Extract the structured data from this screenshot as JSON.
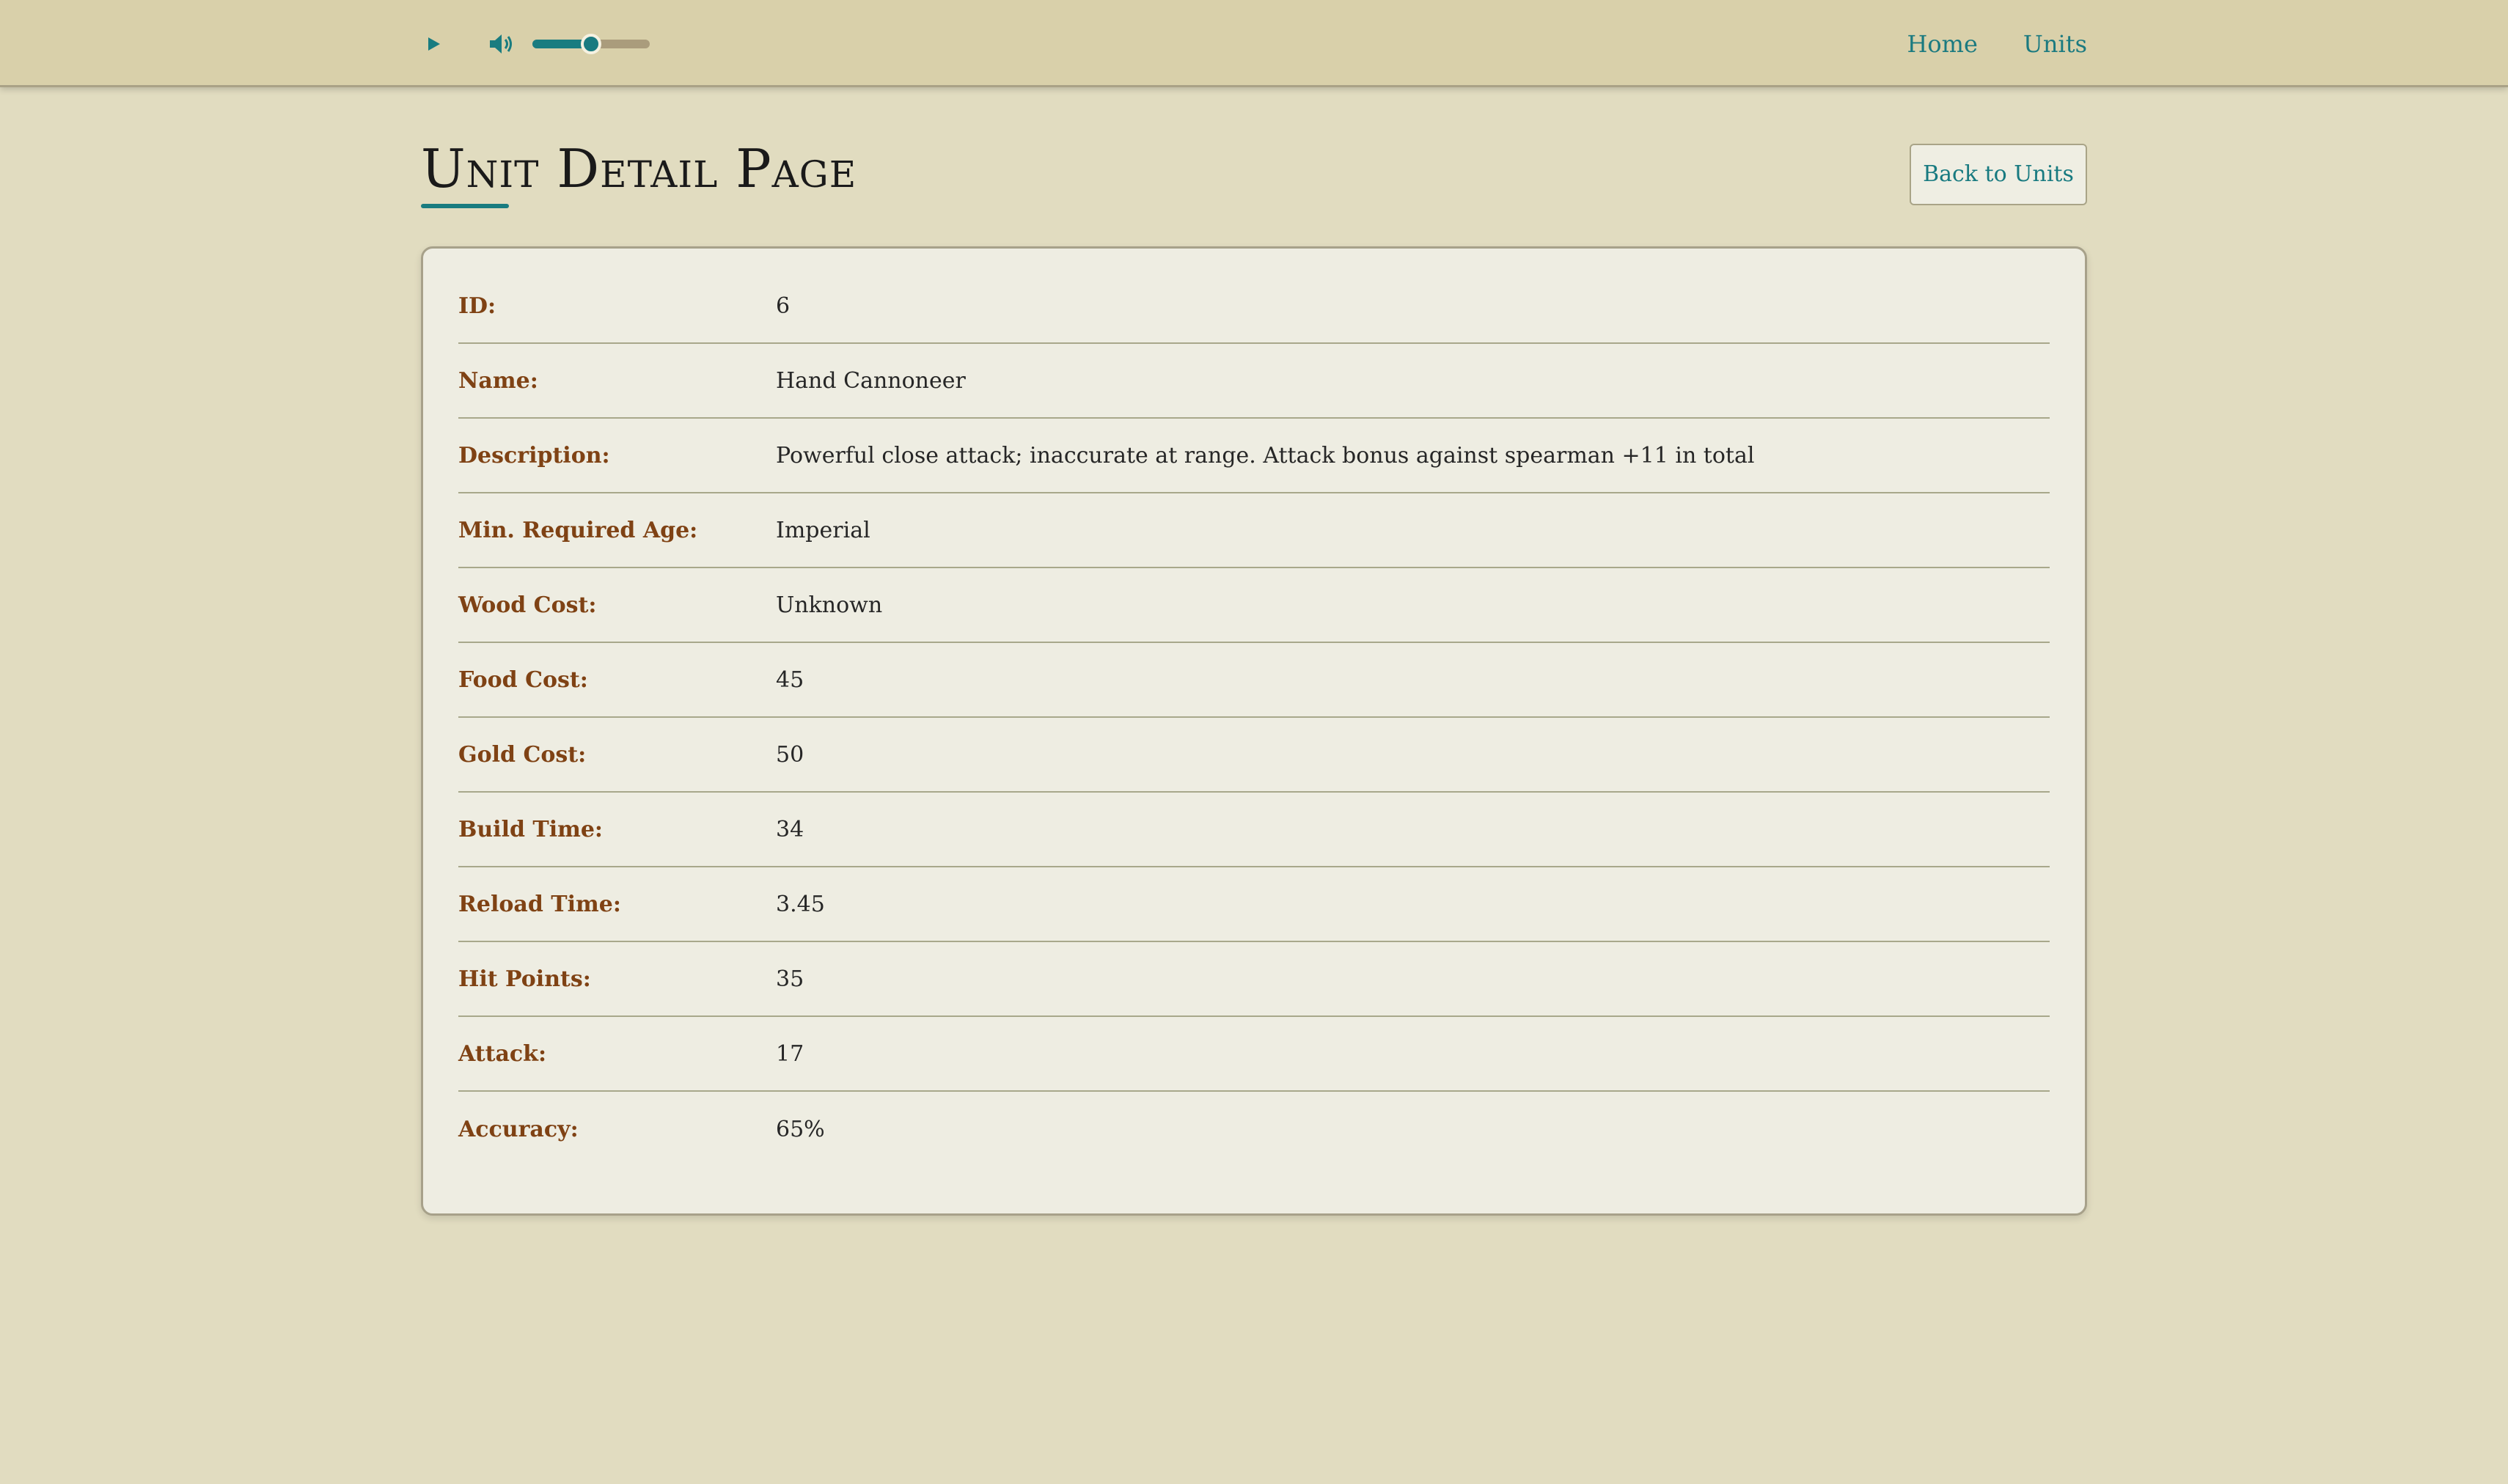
{
  "header": {
    "audio": {
      "volume_fraction": 0.5
    },
    "nav": [
      {
        "label": "Home"
      },
      {
        "label": "Units"
      }
    ]
  },
  "page": {
    "title": "Unit Detail Page",
    "back_button": "Back to Units"
  },
  "unit": {
    "rows": [
      {
        "label": "ID:",
        "value": "6"
      },
      {
        "label": "Name:",
        "value": "Hand Cannoneer"
      },
      {
        "label": "Description:",
        "value": "Powerful close attack; inaccurate at range. Attack bonus against spearman +11 in total"
      },
      {
        "label": "Min. Required Age:",
        "value": "Imperial"
      },
      {
        "label": "Wood Cost:",
        "value": "Unknown"
      },
      {
        "label": "Food Cost:",
        "value": "45"
      },
      {
        "label": "Gold Cost:",
        "value": "50"
      },
      {
        "label": "Build Time:",
        "value": "34"
      },
      {
        "label": "Reload Time:",
        "value": "3.45"
      },
      {
        "label": "Hit Points:",
        "value": "35"
      },
      {
        "label": "Attack:",
        "value": "17"
      },
      {
        "label": "Accuracy:",
        "value": "65%"
      }
    ]
  },
  "colors": {
    "accent": "#197c80",
    "label": "#7f4214",
    "background": "#e1dcc0",
    "topbar": "#d9d0aa"
  }
}
